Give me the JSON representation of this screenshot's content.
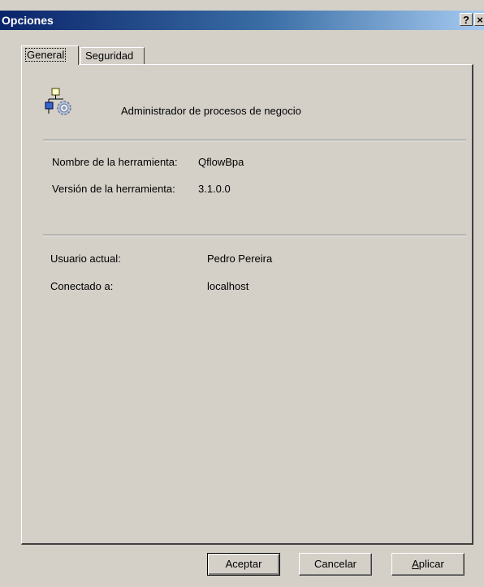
{
  "window": {
    "title": "Opciones",
    "help_glyph": "?",
    "close_glyph": "×"
  },
  "tabs": [
    {
      "label": "General",
      "active": true
    },
    {
      "label": "Seguridad",
      "active": false
    }
  ],
  "general": {
    "icon": "org-chart-gear-icon",
    "app_description": "Administrador de procesos de negocio",
    "tool_name_label": "Nombre de la herramienta:",
    "tool_name_value": "QflowBpa",
    "tool_version_label": "Versión de la herramienta:",
    "tool_version_value": "3.1.0.0",
    "current_user_label": "Usuario actual:",
    "current_user_value": "Pedro Pereira",
    "connected_to_label": "Conectado a:",
    "connected_to_value": "localhost"
  },
  "buttons": {
    "ok": "Aceptar",
    "cancel": "Cancelar",
    "apply_first": "A",
    "apply_rest": "plicar"
  }
}
